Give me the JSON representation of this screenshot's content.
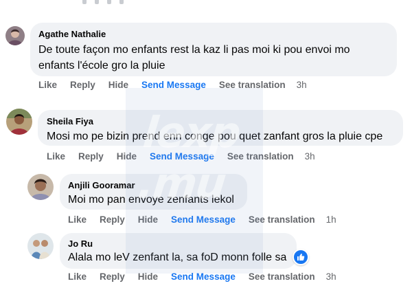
{
  "comments": [
    {
      "author": "Agathe Nathalie",
      "text_lines": [
        "De toute façon mo enfants rest la kaz li pas moi ki pou envoi mo",
        "enfants l'école gro la pluie"
      ],
      "actions": {
        "like": "Like",
        "reply": "Reply",
        "hide": "Hide",
        "send_message": "Send Message",
        "see_translation": "See translation"
      },
      "time": "3h"
    },
    {
      "author": "Sheila Fiya",
      "text_lines": [
        "Mosi mo pe bizin prend enn conge pou quet zanfant gros la pluie cpe"
      ],
      "actions": {
        "like": "Like",
        "reply": "Reply",
        "hide": "Hide",
        "send_message": "Send Message",
        "see_translation": "See translation"
      },
      "time": "3h"
    },
    {
      "author": "Anjili Gooramar",
      "text_lines": [
        "Moi mo pan envoye zenfants lekol"
      ],
      "actions": {
        "like": "Like",
        "reply": "Reply",
        "hide": "Hide",
        "send_message": "Send Message",
        "see_translation": "See translation"
      },
      "time": "1h"
    },
    {
      "author": "Jo Ru",
      "text_lines": [
        "Alala mo leV zenfant la, sa foD monn folle sa"
      ],
      "actions": {
        "like": "Like",
        "reply": "Reply",
        "hide": "Hide",
        "send_message": "Send Message",
        "see_translation": "See translation"
      },
      "time": "3h",
      "reaction_icon": "like-thumb-icon"
    }
  ],
  "watermark": "lexp\n.mu",
  "colors": {
    "bubble": "#f0f2f5",
    "link_blue": "#1877f2",
    "meta_gray": "#65676b",
    "text": "#050505"
  }
}
